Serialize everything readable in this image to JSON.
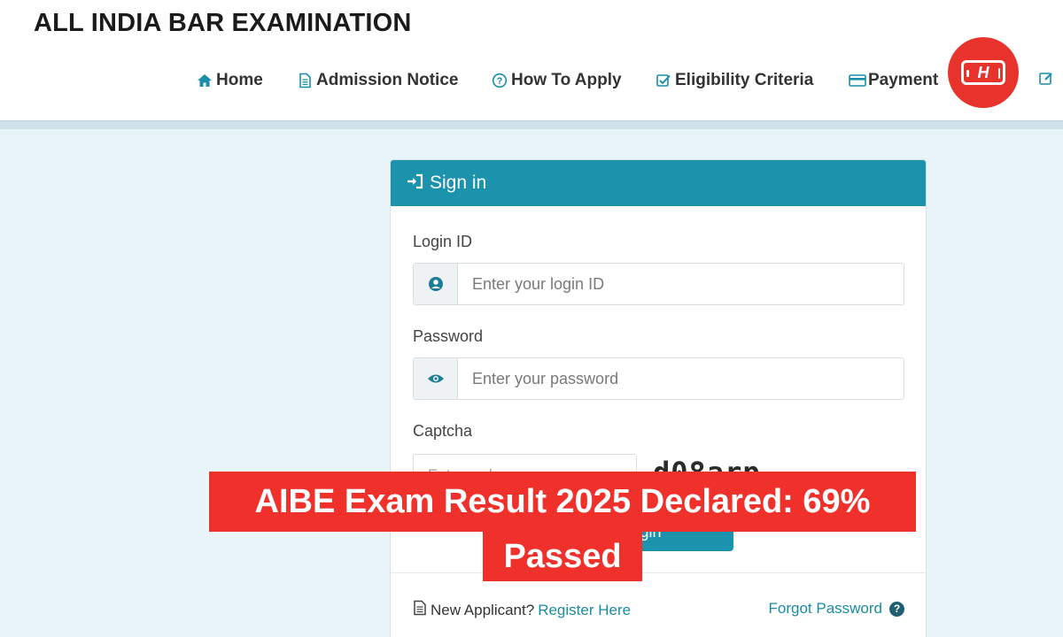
{
  "header": {
    "title": "ALL INDIA BAR EXAMINATION",
    "nav": [
      {
        "label": "Home",
        "icon": "home-icon"
      },
      {
        "label": "Admission Notice",
        "icon": "document-icon"
      },
      {
        "label": "How To Apply",
        "icon": "question-circle-icon"
      },
      {
        "label": "Eligibility Criteria",
        "icon": "check-square-icon"
      },
      {
        "label": "Payment",
        "icon": "credit-card-icon"
      }
    ]
  },
  "brand_badge": {
    "letter": "H",
    "color": "#e8332d"
  },
  "signin": {
    "heading": "Sign in",
    "login_id_label": "Login ID",
    "login_id_placeholder": "Enter your login ID",
    "password_label": "Password",
    "password_placeholder": "Enter your password",
    "captcha_label": "Captcha",
    "captcha_placeholder": "Enter code",
    "captcha_code": "d08arp",
    "login_button": "Login",
    "new_applicant_text": "New Applicant?",
    "register_link": "Register Here",
    "forgot_link": "Forgot Password"
  },
  "headline": {
    "line1": "AIBE Exam Result 2025 Declared: 69%",
    "line2": "Passed"
  },
  "colors": {
    "accent": "#1b93ad",
    "headline_bg": "#f0302b",
    "page_bg": "#e9f4f8"
  }
}
